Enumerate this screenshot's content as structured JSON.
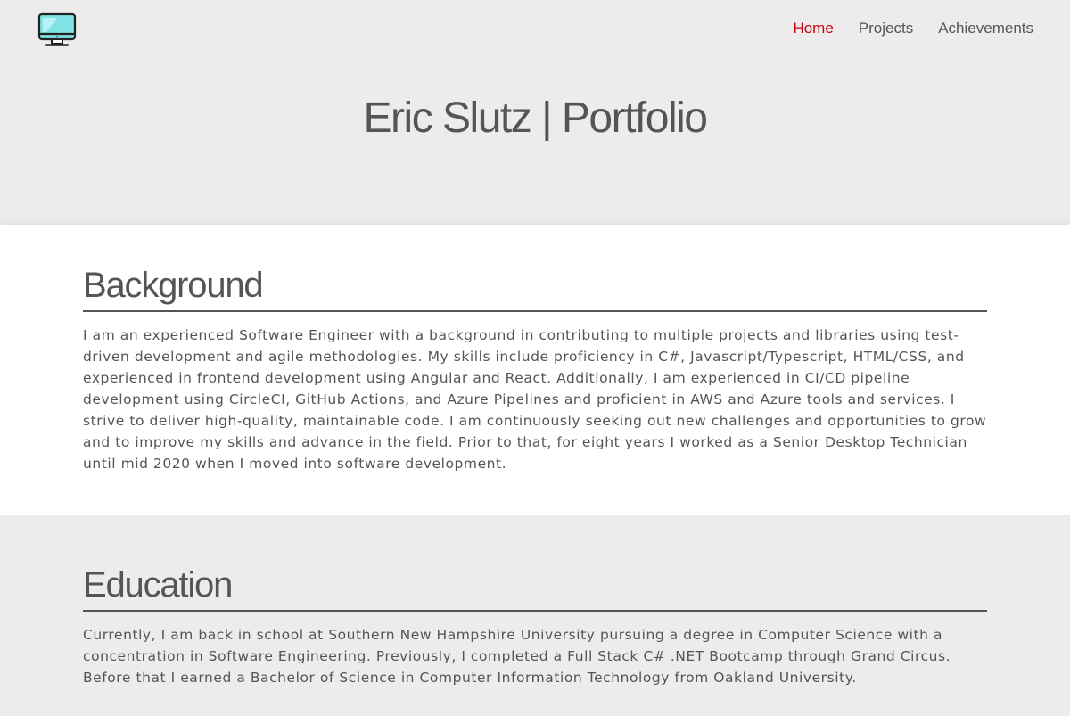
{
  "header": {
    "logo_icon": "desktop-monitor-icon",
    "nav": [
      {
        "label": "Home",
        "active": true
      },
      {
        "label": "Projects",
        "active": false
      },
      {
        "label": "Achievements",
        "active": false
      }
    ],
    "title": "Eric Slutz | Portfolio"
  },
  "background": {
    "heading": "Background",
    "text": "I am an experienced Software Engineer with a background in contributing to multiple projects and libraries using test-driven development and agile methodologies. My skills include proficiency in C#, Javascript/Typescript, HTML/CSS, and experienced in frontend development using Angular and React. Additionally, I am experienced in CI/CD pipeline development using CircleCI, GitHub Actions, and Azure Pipelines and proficient in AWS and Azure tools and services. I strive to deliver high-quality, maintainable code. I am continuously seeking out new challenges and opportunities to grow and to improve my skills and advance in the field. Prior to that, for eight years I worked as a Senior Desktop Technician until mid 2020 when I moved into software development."
  },
  "education": {
    "heading": "Education",
    "text": "Currently, I am back in school at Southern New Hampshire University pursuing a degree in Computer Science with a concentration in Software Engineering. Previously, I completed a Full Stack C# .NET Bootcamp through Grand Circus. Before that I earned a Bachelor of Science in Computer Information Technology from Oakland University."
  },
  "colors": {
    "accent": "#c7000b",
    "text": "#555555",
    "header_bg": "#ececec",
    "section_white": "#ffffff",
    "monitor_screen": "#7fe3e6"
  }
}
